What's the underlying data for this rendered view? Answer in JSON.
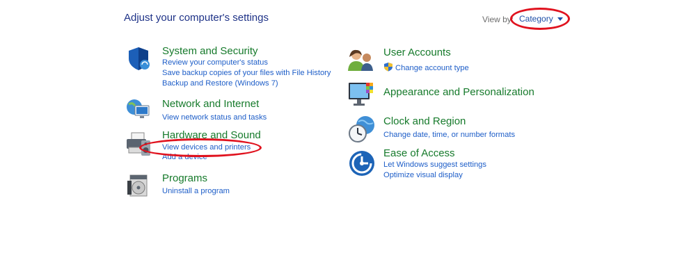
{
  "header": {
    "title": "Adjust your computer's settings",
    "view_by_label": "View by:",
    "view_by_value": "Category"
  },
  "categories": {
    "system_security": {
      "title": "System and Security",
      "links": [
        "Review your computer's status",
        "Save backup copies of your files with File History",
        "Backup and Restore (Windows 7)"
      ]
    },
    "network": {
      "title": "Network and Internet",
      "links": [
        "View network status and tasks"
      ]
    },
    "hardware": {
      "title": "Hardware and Sound",
      "links": [
        "View devices and printers",
        "Add a device"
      ]
    },
    "programs": {
      "title": "Programs",
      "links": [
        "Uninstall a program"
      ]
    },
    "user_accounts": {
      "title": "User Accounts",
      "links": [
        "Change account type"
      ]
    },
    "appearance": {
      "title": "Appearance and Personalization",
      "links": []
    },
    "clock": {
      "title": "Clock and Region",
      "links": [
        "Change date, time, or number formats"
      ]
    },
    "ease": {
      "title": "Ease of Access",
      "links": [
        "Let Windows suggest settings",
        "Optimize visual display"
      ]
    }
  },
  "icons": {
    "system_security": "shield-icon",
    "network": "network-globe-icon",
    "hardware": "printer-speaker-icon",
    "programs": "programs-disc-icon",
    "user_accounts": "users-icon",
    "appearance": "monitor-palette-icon",
    "clock": "clock-globe-icon",
    "ease": "ease-of-access-icon",
    "uac": "uac-shield-icon"
  },
  "colors": {
    "title": "#1e3287",
    "category": "#167a2b",
    "link": "#1e5ec8",
    "highlight": "#e0121e"
  }
}
